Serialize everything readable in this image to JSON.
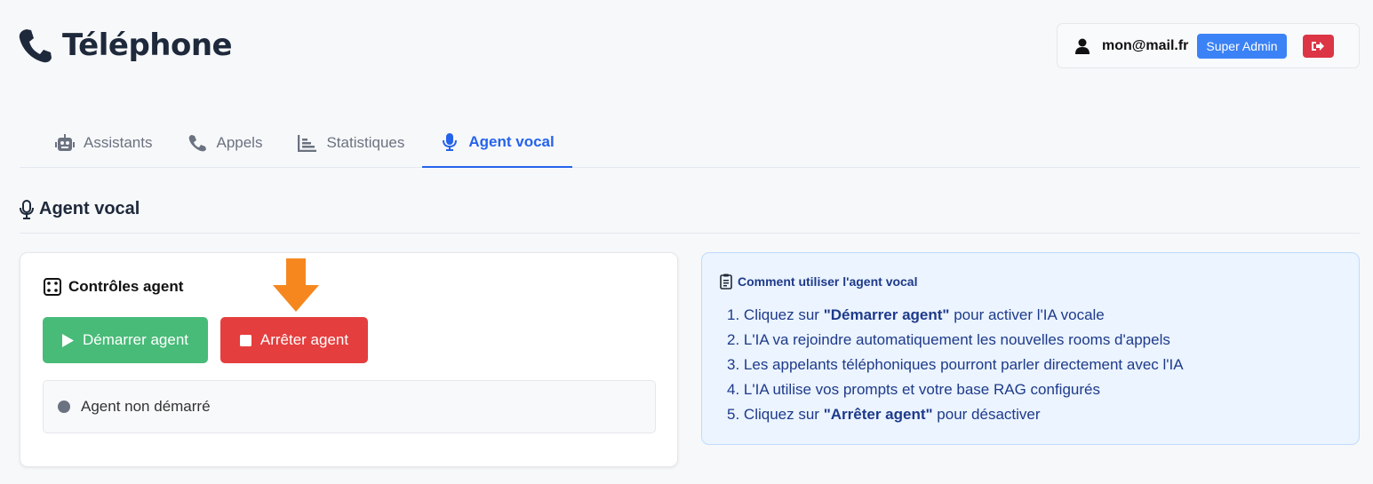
{
  "page": {
    "title": "Téléphone",
    "title_icon": "phone-icon"
  },
  "user": {
    "email": "mon@mail.fr",
    "role_badge": "Super Admin",
    "logout_icon": "sign-out-icon",
    "badge_color": "#3b82f6",
    "logout_color": "#dc3545"
  },
  "tabs": [
    {
      "label": "Assistants",
      "icon": "robot-icon",
      "active": false
    },
    {
      "label": "Appels",
      "icon": "phone-icon",
      "active": false
    },
    {
      "label": "Statistiques",
      "icon": "chart-icon",
      "active": false
    },
    {
      "label": "Agent vocal",
      "icon": "microphone-icon",
      "active": true
    }
  ],
  "section": {
    "title": "Agent vocal",
    "icon": "microphone-icon"
  },
  "controls": {
    "title": "Contrôles agent",
    "icon": "dice-icon",
    "start_label": "Démarrer agent",
    "stop_label": "Arrêter agent",
    "status_text": "Agent non démarré",
    "start_color": "#48bb78",
    "stop_color": "#e53e3e",
    "annotation_color": "#f6871f"
  },
  "help": {
    "title": "Comment utiliser l'agent vocal",
    "icon": "clipboard-icon",
    "steps": [
      {
        "num": "1.",
        "before": "Cliquez sur ",
        "bold": "\"Démarrer agent\"",
        "after": " pour activer l'IA vocale"
      },
      {
        "num": "2.",
        "before": "L'IA va rejoindre automatiquement les nouvelles rooms d'appels",
        "bold": "",
        "after": ""
      },
      {
        "num": "3.",
        "before": "Les appelants téléphoniques pourront parler directement avec l'IA",
        "bold": "",
        "after": ""
      },
      {
        "num": "4.",
        "before": "L'IA utilise vos prompts et votre base RAG configurés",
        "bold": "",
        "after": ""
      },
      {
        "num": "5.",
        "before": "Cliquez sur ",
        "bold": "\"Arrêter agent\"",
        "after": " pour désactiver"
      }
    ]
  }
}
